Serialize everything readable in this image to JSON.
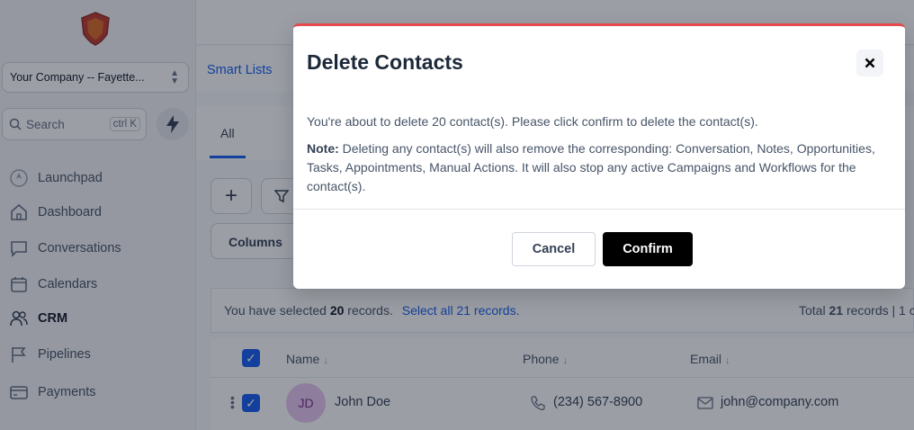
{
  "sidebar": {
    "company": "Your Company -- Fayette...",
    "search_placeholder": "Search",
    "search_shortcut": "ctrl K",
    "items": [
      {
        "label": "Launchpad",
        "icon": "rocket-icon"
      },
      {
        "label": "Dashboard",
        "icon": "home-icon"
      },
      {
        "label": "Conversations",
        "icon": "chat-icon"
      },
      {
        "label": "Calendars",
        "icon": "calendar-icon"
      },
      {
        "label": "CRM",
        "icon": "users-icon",
        "active": true
      },
      {
        "label": "Pipelines",
        "icon": "flag-icon"
      },
      {
        "label": "Payments",
        "icon": "credit-card-icon"
      }
    ]
  },
  "subnav": {
    "smart_lists": "Smart Lists"
  },
  "tabs": {
    "all": "All"
  },
  "toolbar": {
    "columns": "Columns"
  },
  "selection": {
    "prefix": "You have selected",
    "count": "20",
    "suffix": "records.",
    "select_all": "Select all 21 records.",
    "total_prefix": "Total",
    "total": "21",
    "total_suffix": "records | 1 c"
  },
  "table": {
    "headers": {
      "name": "Name",
      "phone": "Phone",
      "email": "Email"
    },
    "rows": [
      {
        "initials": "JD",
        "name": "John Doe",
        "phone": "(234) 567-8900",
        "email": "john@company.com"
      }
    ]
  },
  "modal": {
    "title": "Delete Contacts",
    "message": "You're about to delete 20 contact(s). Please click confirm to delete the contact(s).",
    "note_label": "Note:",
    "note_text": " Deleting any contact(s) will also remove the corresponding: Conversation, Notes, Opportunities, Tasks, Appointments, Manual Actions. It will also stop any active Campaigns and Workflows for the contact(s).",
    "cancel": "Cancel",
    "confirm": "Confirm"
  },
  "colors": {
    "accent": "#155eef",
    "danger_top": "#e5484d",
    "confirm_bg": "#000000"
  }
}
